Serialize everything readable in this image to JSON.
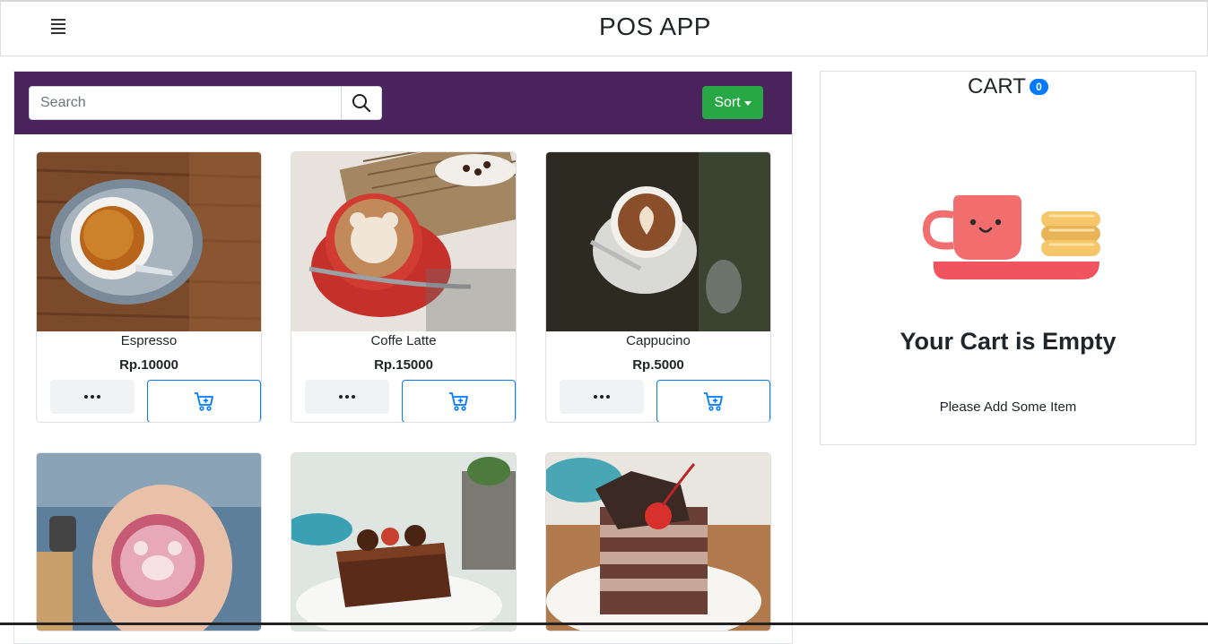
{
  "header": {
    "title": "POS APP",
    "menu_icon": "hamburger-icon"
  },
  "toolbar": {
    "search_placeholder": "Search",
    "search_icon": "search-icon",
    "sort_label": "Sort"
  },
  "products": [
    {
      "name": "Espresso",
      "price": "Rp.10000"
    },
    {
      "name": "Coffe Latte",
      "price": "Rp.15000"
    },
    {
      "name": "Cappucino",
      "price": "Rp.5000"
    },
    {
      "name": "",
      "price": ""
    },
    {
      "name": "",
      "price": ""
    },
    {
      "name": "",
      "price": ""
    }
  ],
  "cart": {
    "title": "CART",
    "count": "0",
    "empty_title": "Your Cart is Empty",
    "empty_message": "Please Add Some Item",
    "illustration": "empty-cart-cup-icon"
  },
  "colors": {
    "toolbar_bg": "#4b235c",
    "sort_button": "#28a745",
    "primary": "#007bff",
    "cup": "#f26d6d"
  }
}
